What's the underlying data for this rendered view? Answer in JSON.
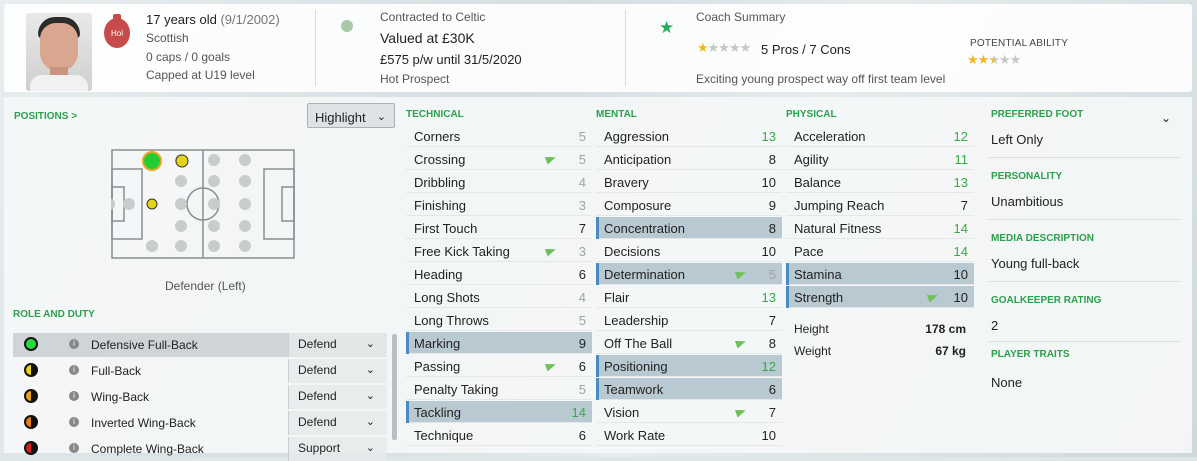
{
  "header": {
    "age_text": "17 years old",
    "dob": "(9/1/2002)",
    "nationality": "Scottish",
    "caps": "0 caps / 0 goals",
    "capped_at": "Capped at U19 level",
    "nation_badge": "Hol",
    "contract_text": "Contracted to Celtic",
    "value_text": "Valued at £30K",
    "wage_text": "£575 p/w until 31/5/2020",
    "status_text": "Hot Prospect",
    "coach_summary_title": "Coach Summary",
    "coach_stars": 1,
    "pros_cons": "5 Pros / 7 Cons",
    "coach_note": "Exciting young prospect way off first team level",
    "potential_label": "POTENTIAL ABILITY",
    "potential_stars": 2.5
  },
  "positions": {
    "title": "POSITIONS >",
    "highlight_label": "Highlight",
    "position_label": "Defender (Left)"
  },
  "roles": {
    "title": "ROLE AND DUTY",
    "items": [
      {
        "name": "Defensive Full-Back",
        "duty": "Defend",
        "fill": "#22dd3a",
        "style": "full"
      },
      {
        "name": "Full-Back",
        "duty": "Defend",
        "fill": "#e8d21a",
        "style": "half"
      },
      {
        "name": "Wing-Back",
        "duty": "Defend",
        "fill": "#e8a21a",
        "style": "half"
      },
      {
        "name": "Inverted Wing-Back",
        "duty": "Defend",
        "fill": "#e8801a",
        "style": "half"
      },
      {
        "name": "Complete Wing-Back",
        "duty": "Support",
        "fill": "#d02020",
        "style": "half"
      }
    ]
  },
  "technical": {
    "title": "TECHNICAL",
    "items": [
      {
        "name": "Corners",
        "value": "5",
        "tone": "grey",
        "hl": false,
        "arrow": false
      },
      {
        "name": "Crossing",
        "value": "5",
        "tone": "grey",
        "hl": false,
        "arrow": true
      },
      {
        "name": "Dribbling",
        "value": "4",
        "tone": "grey",
        "hl": false,
        "arrow": false
      },
      {
        "name": "Finishing",
        "value": "3",
        "tone": "grey",
        "hl": false,
        "arrow": false
      },
      {
        "name": "First Touch",
        "value": "7",
        "tone": "dark",
        "hl": false,
        "arrow": false
      },
      {
        "name": "Free Kick Taking",
        "value": "3",
        "tone": "grey",
        "hl": false,
        "arrow": true
      },
      {
        "name": "Heading",
        "value": "6",
        "tone": "dark",
        "hl": false,
        "arrow": false
      },
      {
        "name": "Long Shots",
        "value": "4",
        "tone": "grey",
        "hl": false,
        "arrow": false
      },
      {
        "name": "Long Throws",
        "value": "5",
        "tone": "grey",
        "hl": false,
        "arrow": false
      },
      {
        "name": "Marking",
        "value": "9",
        "tone": "dark",
        "hl": true,
        "arrow": false
      },
      {
        "name": "Passing",
        "value": "6",
        "tone": "dark",
        "hl": false,
        "arrow": true
      },
      {
        "name": "Penalty Taking",
        "value": "5",
        "tone": "grey",
        "hl": false,
        "arrow": false
      },
      {
        "name": "Tackling",
        "value": "14",
        "tone": "green",
        "hl": true,
        "arrow": false
      },
      {
        "name": "Technique",
        "value": "6",
        "tone": "dark",
        "hl": false,
        "arrow": false
      }
    ]
  },
  "mental": {
    "title": "MENTAL",
    "items": [
      {
        "name": "Aggression",
        "value": "13",
        "tone": "green",
        "hl": false,
        "arrow": false
      },
      {
        "name": "Anticipation",
        "value": "8",
        "tone": "dark",
        "hl": false,
        "arrow": false
      },
      {
        "name": "Bravery",
        "value": "10",
        "tone": "dark",
        "hl": false,
        "arrow": false
      },
      {
        "name": "Composure",
        "value": "9",
        "tone": "dark",
        "hl": false,
        "arrow": false
      },
      {
        "name": "Concentration",
        "value": "8",
        "tone": "dark",
        "hl": true,
        "arrow": false
      },
      {
        "name": "Decisions",
        "value": "10",
        "tone": "dark",
        "hl": false,
        "arrow": false
      },
      {
        "name": "Determination",
        "value": "5",
        "tone": "grey",
        "hl": true,
        "arrow": true
      },
      {
        "name": "Flair",
        "value": "13",
        "tone": "green",
        "hl": false,
        "arrow": false
      },
      {
        "name": "Leadership",
        "value": "7",
        "tone": "dark",
        "hl": false,
        "arrow": false
      },
      {
        "name": "Off The Ball",
        "value": "8",
        "tone": "dark",
        "hl": false,
        "arrow": true
      },
      {
        "name": "Positioning",
        "value": "12",
        "tone": "green",
        "hl": true,
        "arrow": false
      },
      {
        "name": "Teamwork",
        "value": "6",
        "tone": "dark",
        "hl": true,
        "arrow": false
      },
      {
        "name": "Vision",
        "value": "7",
        "tone": "dark",
        "hl": false,
        "arrow": true
      },
      {
        "name": "Work Rate",
        "value": "10",
        "tone": "dark",
        "hl": false,
        "arrow": false
      }
    ]
  },
  "physical": {
    "title": "PHYSICAL",
    "items": [
      {
        "name": "Acceleration",
        "value": "12",
        "tone": "green",
        "hl": false,
        "arrow": false
      },
      {
        "name": "Agility",
        "value": "11",
        "tone": "green",
        "hl": false,
        "arrow": false
      },
      {
        "name": "Balance",
        "value": "13",
        "tone": "green",
        "hl": false,
        "arrow": false
      },
      {
        "name": "Jumping Reach",
        "value": "7",
        "tone": "dark",
        "hl": false,
        "arrow": false
      },
      {
        "name": "Natural Fitness",
        "value": "14",
        "tone": "green",
        "hl": false,
        "arrow": false
      },
      {
        "name": "Pace",
        "value": "14",
        "tone": "green",
        "hl": false,
        "arrow": false
      },
      {
        "name": "Stamina",
        "value": "10",
        "tone": "dark",
        "hl": true,
        "arrow": false
      },
      {
        "name": "Strength",
        "value": "10",
        "tone": "dark",
        "hl": true,
        "arrow": true
      }
    ],
    "height_label": "Height",
    "height_value": "178 cm",
    "weight_label": "Weight",
    "weight_value": "67 kg"
  },
  "info": {
    "preferred_foot_title": "PREFERRED FOOT",
    "preferred_foot": "Left Only",
    "personality_title": "PERSONALITY",
    "personality": "Unambitious",
    "media_title": "MEDIA DESCRIPTION",
    "media": "Young full-back",
    "gk_title": "GOALKEEPER RATING",
    "gk": "2",
    "traits_title": "PLAYER TRAITS",
    "traits": "None"
  },
  "colors": {
    "accent_green": "#2aa14d",
    "highlight_row": "#b9c9d2",
    "star": "#f0b81f"
  }
}
